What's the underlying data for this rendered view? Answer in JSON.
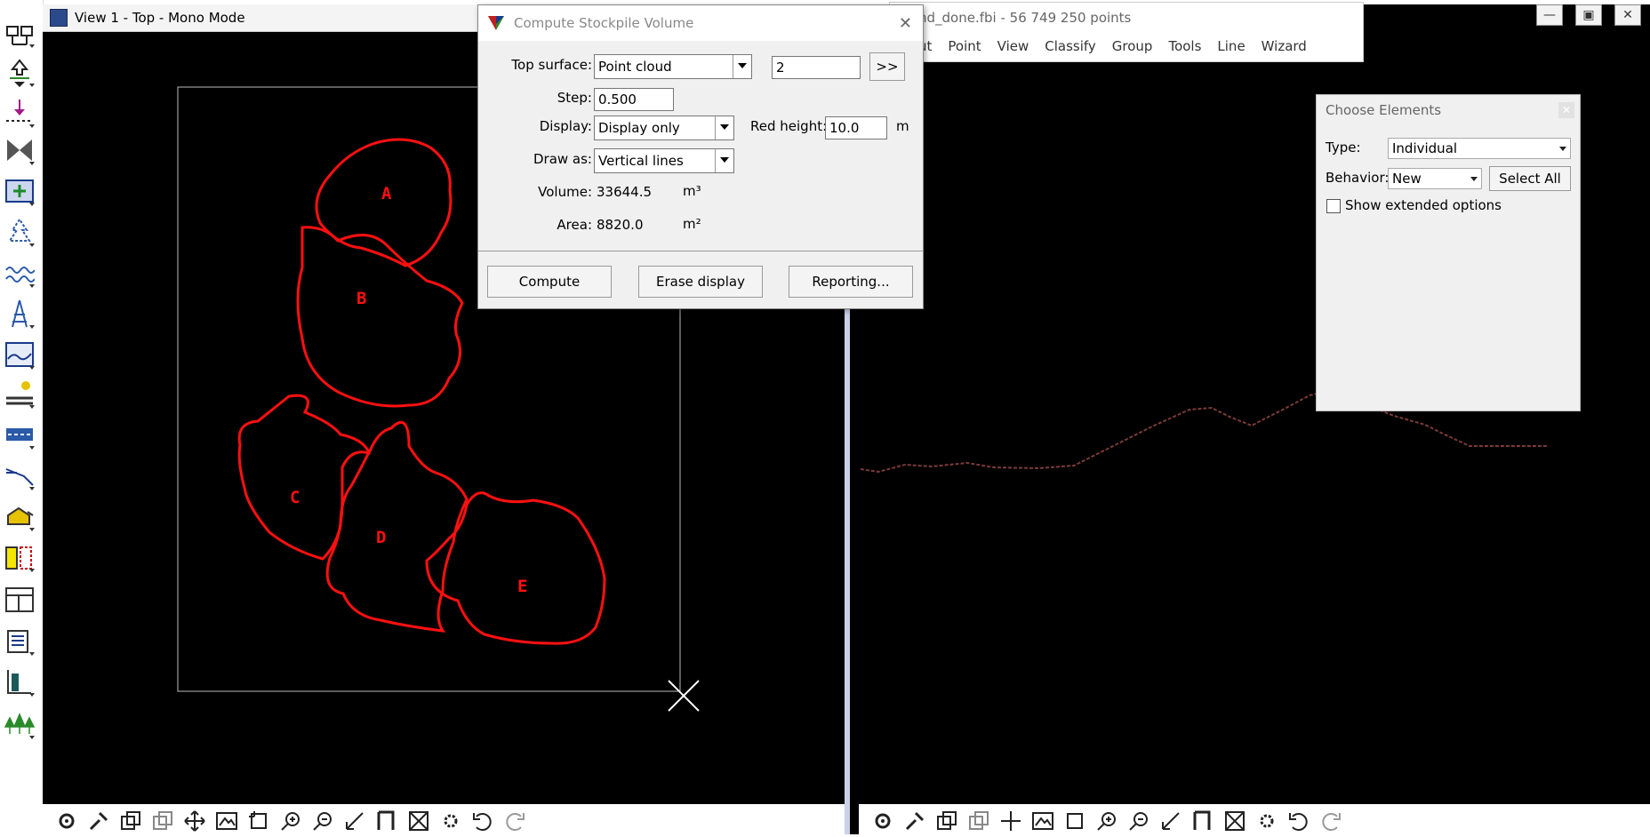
{
  "view1": {
    "title": "View 1 - Top - Mono Mode"
  },
  "dialog": {
    "title": "Compute Stockpile Volume",
    "top_surface_label": "Top surface:",
    "top_surface_value": "Point cloud",
    "class_value": "2",
    "more_button": ">>",
    "step_label": "Step:",
    "step_value": "0.500",
    "display_label": "Display:",
    "display_value": "Display only",
    "red_height_label": "Red height:",
    "red_height_value": "10.0",
    "red_height_unit": "m",
    "draw_as_label": "Draw as:",
    "draw_as_value": "Vertical lines",
    "volume_label": "Volume:",
    "volume_value": "33644.5",
    "volume_unit": "m³",
    "area_label": "Area:",
    "area_value": "8820.0",
    "area_unit": "m²",
    "compute_button": "Compute",
    "erase_button": "Erase display",
    "reporting_button": "Reporting..."
  },
  "main_window": {
    "title_partial": "nd_done.fbi - 56 749 250 points",
    "menu": [
      "ut",
      "Point",
      "View",
      "Classify",
      "Group",
      "Tools",
      "Line",
      "Wizard"
    ]
  },
  "choose_elements": {
    "title": "Choose Elements",
    "type_label": "Type:",
    "type_value": "Individual",
    "behavior_label": "Behavior:",
    "behavior_value": "New",
    "select_all_button": "Select All",
    "show_extended_label": "Show extended options"
  },
  "stockpiles": [
    "A",
    "B",
    "C",
    "D",
    "E"
  ],
  "colors": {
    "stockpile_outline": "#ff1010",
    "profile": "#7a3a3a",
    "canvas": "#000000"
  },
  "left_toolbar_icons": [
    "place-boundary-icon",
    "move-element-icon",
    "drape-point-icon",
    "cut-section-icon",
    "select-area-icon",
    "vectorize-tree-icon",
    "break-line-icon",
    "tower-icon",
    "profile-view-icon",
    "light-pole-icon",
    "road-marking-icon",
    "slope-line-icon",
    "building-icon",
    "column-icon",
    "layout-icon",
    "report-icon",
    "bar-chart-icon",
    "trees-icon"
  ],
  "bottom_toolbar_icons": [
    "settings-icon",
    "brush-icon",
    "copy-view-icon",
    "overlay-icon",
    "pan-icon",
    "fit-view-icon",
    "window-zoom-icon",
    "zoom-in-icon",
    "zoom-out-icon",
    "rotate-icon",
    "frame-icon",
    "fit-extent-icon",
    "display-settings-icon",
    "undo-icon",
    "redo-icon"
  ]
}
